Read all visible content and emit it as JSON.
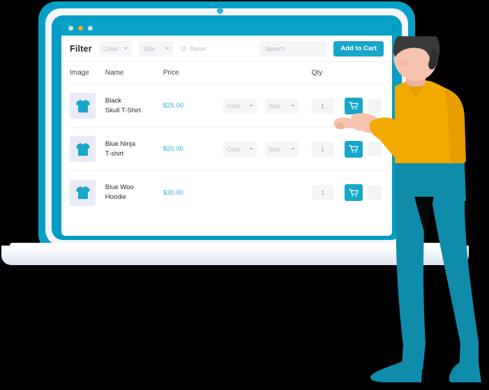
{
  "window": {
    "traffic_lights": [
      "blue",
      "amber",
      "blue"
    ]
  },
  "filter_bar": {
    "title": "Filter",
    "color_select": {
      "label": "Color",
      "icon": "chevron-down-icon"
    },
    "size_select": {
      "label": "Size",
      "icon": "chevron-down-icon"
    },
    "reset": {
      "label": "Reset",
      "icon": "refresh-icon"
    },
    "search": {
      "placeholder": "Search",
      "value": ""
    },
    "add_to_cart": {
      "label": "Add to Cart"
    }
  },
  "table": {
    "headers": [
      "Image",
      "Name",
      "Price",
      "",
      "Qty",
      ""
    ],
    "rows": [
      {
        "image_icon": "tshirt-icon",
        "name": "Black\nSkull T-Shirt",
        "name_line1": "Black",
        "name_line2": "Skull T-Shirt",
        "price": "$25.00",
        "color_option": "Color",
        "size_option": "Size",
        "qty": "1",
        "action_icon": "shopping-cart-icon",
        "has_options": true
      },
      {
        "image_icon": "tshirt-icon",
        "name": "Blue Ninja\nT-shirt",
        "name_line1": "Blue Ninja",
        "name_line2": "T-shirt",
        "price": "$20.00",
        "color_option": "Color",
        "size_option": "Size",
        "qty": "1",
        "action_icon": "shopping-cart-icon",
        "has_options": true
      },
      {
        "image_icon": "tshirt-icon",
        "name": "Blue Woo\nHoodie",
        "name_line1": "Blue Woo",
        "name_line2": "Hoodie",
        "price": "$30.00",
        "color_option": "",
        "size_option": "",
        "qty": "1",
        "action_icon": "shopping-cart-icon",
        "has_options": false
      }
    ]
  },
  "illustration": {
    "character": "man-pointing-at-screen",
    "shirt_color": "#F2A900",
    "pants_color": "#0F8CAA",
    "skin_color": "#F4B9A8",
    "hair_color": "#3A3A3A"
  },
  "colors": {
    "accent_teal": "#16A7C9",
    "laptop_frame": "#06A0C6",
    "titlebar": "#08A2C8",
    "price_text": "#27B4D8",
    "muted_text": "#B7BCC4",
    "thumb_bg": "#EBEAF7",
    "field_bg": "#F4F5F7",
    "background": "#000000"
  }
}
